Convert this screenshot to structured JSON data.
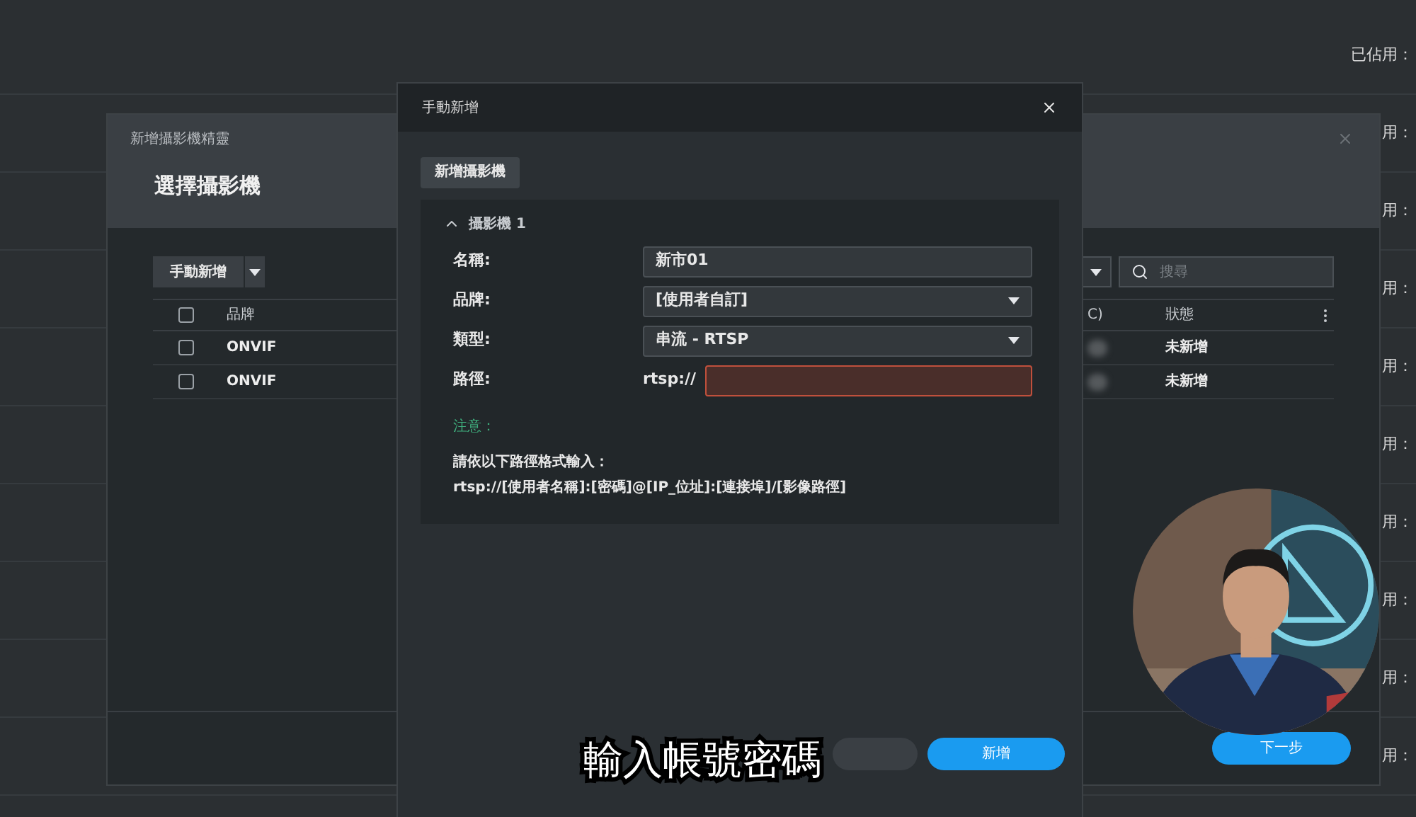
{
  "background_page": {
    "usage_labels": [
      "已佔用：",
      "用：",
      "用：",
      "用：",
      "用：",
      "用：",
      "用：",
      "用：",
      "用：",
      "用："
    ]
  },
  "wizard": {
    "breadcrumb": "新增攝影機精靈",
    "title": "選擇攝影機",
    "add_button": "手動新增",
    "search": {
      "placeholder": "搜尋"
    },
    "table": {
      "header_checked": false,
      "columns": [
        "品牌",
        "C)",
        "狀態"
      ],
      "rows": [
        {
          "checked": false,
          "brand": "ONVIF",
          "status": "未新增"
        },
        {
          "checked": false,
          "brand": "ONVIF",
          "status": "未新增"
        }
      ]
    },
    "next_button": "下一步"
  },
  "dialog": {
    "title": "手動新增",
    "tab": "新增攝影機",
    "camera_section": {
      "title": "攝影機 1",
      "expanded": true,
      "fields": [
        {
          "kind": "text",
          "label": "名稱:",
          "value": "新市01"
        },
        {
          "kind": "select",
          "label": "品牌:",
          "value": "[使用者自訂]"
        },
        {
          "kind": "select",
          "label": "類型:",
          "value": "串流 - RTSP"
        },
        {
          "kind": "prefixed",
          "label": "路徑:",
          "prefix": "rtsp://",
          "invalid": true
        }
      ],
      "note": {
        "title": "注意：",
        "lines": [
          "請依以下路徑格式輸入：",
          "rtsp://[使用者名稱]:[密碼]@[IP_位址]:[連接埠]/[影像路徑]"
        ]
      }
    },
    "buttons": [
      {
        "kind": "secondary"
      },
      {
        "kind": "primary",
        "label": "新增"
      }
    ]
  },
  "subtitle": "輸入帳號密碼"
}
